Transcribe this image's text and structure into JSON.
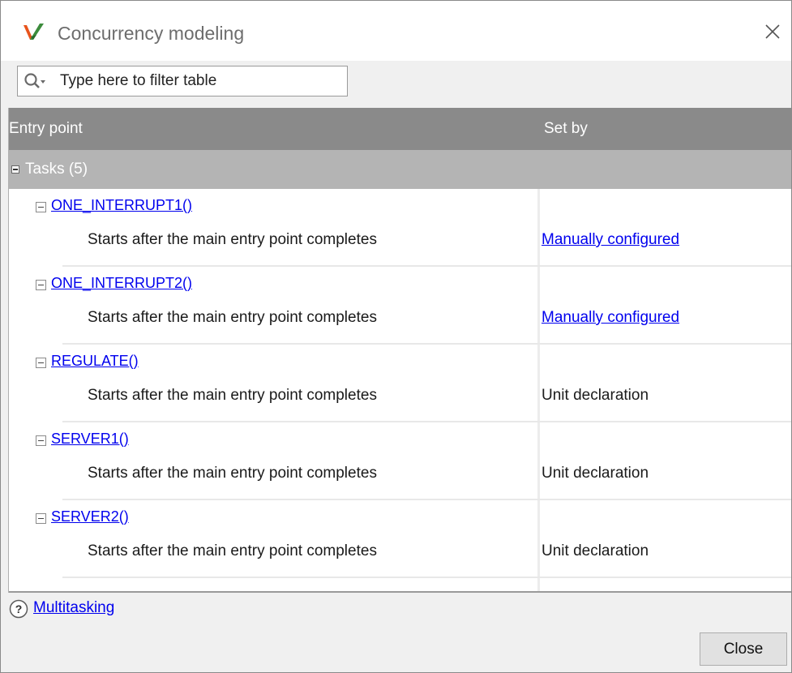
{
  "window": {
    "title": "Concurrency modeling"
  },
  "filter": {
    "placeholder": "Type here to filter table",
    "value": ""
  },
  "table": {
    "columns": [
      "Entry point",
      "Set by"
    ],
    "group": {
      "label": "Tasks (5)"
    },
    "rows": [
      {
        "entry": "ONE_INTERRUPT1()",
        "description": "Starts after the main entry point completes",
        "set_by": "Manually configured",
        "set_by_is_link": true
      },
      {
        "entry": "ONE_INTERRUPT2()",
        "description": "Starts after the main entry point completes",
        "set_by": "Manually configured",
        "set_by_is_link": true
      },
      {
        "entry": "REGULATE()",
        "description": "Starts after the main entry point completes",
        "set_by": "Unit declaration",
        "set_by_is_link": false
      },
      {
        "entry": "SERVER1()",
        "description": "Starts after the main entry point completes",
        "set_by": "Unit declaration",
        "set_by_is_link": false
      },
      {
        "entry": "SERVER2()",
        "description": "Starts after the main entry point completes",
        "set_by": "Unit declaration",
        "set_by_is_link": false
      }
    ]
  },
  "footer": {
    "help_link": "Multitasking",
    "close_label": "Close"
  },
  "icons": {
    "app": "matlab-v-icon",
    "close": "close-icon",
    "search": "search-icon",
    "help": "help-icon"
  },
  "colors": {
    "header_bg": "#8a8a8a",
    "group_bg": "#b4b4b4",
    "link": "#0000ee"
  }
}
